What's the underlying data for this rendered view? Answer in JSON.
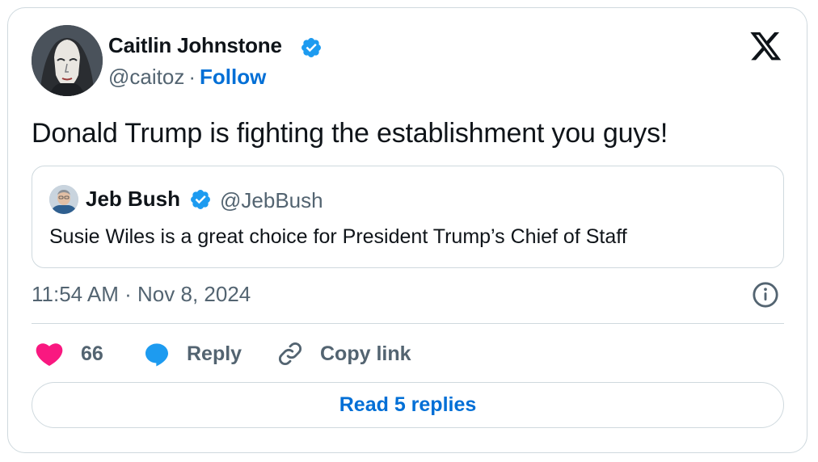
{
  "author": {
    "name": "Caitlin Johnstone",
    "handle": "@caitoz",
    "separator": "·",
    "follow_label": "Follow",
    "avatar_icon": "avatar-caitlin",
    "verified_icon": "verified-badge-icon"
  },
  "brand": {
    "logo": "x-logo-icon"
  },
  "tweet": {
    "text": "Donald Trump is fighting the establishment you guys!"
  },
  "quoted_tweet": {
    "name": "Jeb Bush",
    "handle": "@JebBush",
    "text": "Susie Wiles is a great choice for President Trump’s Chief of Staff",
    "avatar_icon": "avatar-jeb"
  },
  "meta": {
    "timestamp": "11:54 AM · Nov 8, 2024",
    "info_icon": "info-icon"
  },
  "actions": {
    "like_count": "66",
    "reply_label": "Reply",
    "copy_link_label": "Copy link"
  },
  "footer": {
    "read_replies_label": "Read 5 replies"
  },
  "colors": {
    "link_blue": "#006fd6",
    "verified_blue": "#1d9bf0",
    "like_pink": "#f91880",
    "secondary_text": "#536471",
    "border": "#cfd9de"
  }
}
